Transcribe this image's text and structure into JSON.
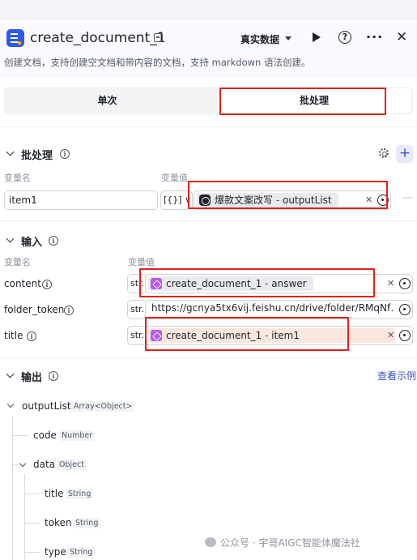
{
  "header": {
    "title": "create_document_1",
    "data_mode": "真实数据",
    "description": "创建文档，支持创建空文档和带内容的文档，支持 markdown 语法创建。"
  },
  "mode_tabs": {
    "single": "单次",
    "batch": "批处理"
  },
  "batch": {
    "title": "批处理",
    "col_name": "变量名",
    "col_value": "变量值",
    "row": {
      "name": "item1",
      "type": "[{}]",
      "ref_node": "爆款文案改写",
      "ref_field": "outputList",
      "sep": " - "
    }
  },
  "inputs": {
    "title": "输入",
    "col_name": "变量名",
    "col_value": "变量值",
    "rows": [
      {
        "name": "content",
        "type": "str.",
        "ref_node": "create_document_1",
        "ref_field": "answer",
        "sep": " - "
      },
      {
        "name": "folder_token",
        "type": "str.",
        "value": "https://gcnya5tx6vij.feishu.cn/drive/folder/RMqNf…"
      },
      {
        "name": "title",
        "type": "str.",
        "ref_node": "create_document_1",
        "ref_field": "item1",
        "sep": " - "
      }
    ]
  },
  "outputs": {
    "title": "输出",
    "view_example": "查看示例",
    "tree": [
      {
        "name": "outputList",
        "type": "Array<Object>"
      },
      {
        "name": "code",
        "type": "Number"
      },
      {
        "name": "data",
        "type": "Object"
      },
      {
        "name": "title",
        "type": "String"
      },
      {
        "name": "token",
        "type": "String"
      },
      {
        "name": "type",
        "type": "String"
      }
    ]
  },
  "watermark": "公众号 · 宇哥AIGC智能体魔法社",
  "icons": [
    "doc-app-icon",
    "tag-icon",
    "caret-down-icon",
    "play-icon",
    "help-icon",
    "more-icon",
    "close-icon",
    "gear-icon",
    "plus-icon",
    "info-icon",
    "chevron-down-icon",
    "node-icon",
    "target-icon",
    "clear-icon",
    "wechat-icon"
  ],
  "colors": {
    "accent": "#3451d1",
    "highlight": "#e2231a",
    "node_purple": "#b45be8"
  }
}
